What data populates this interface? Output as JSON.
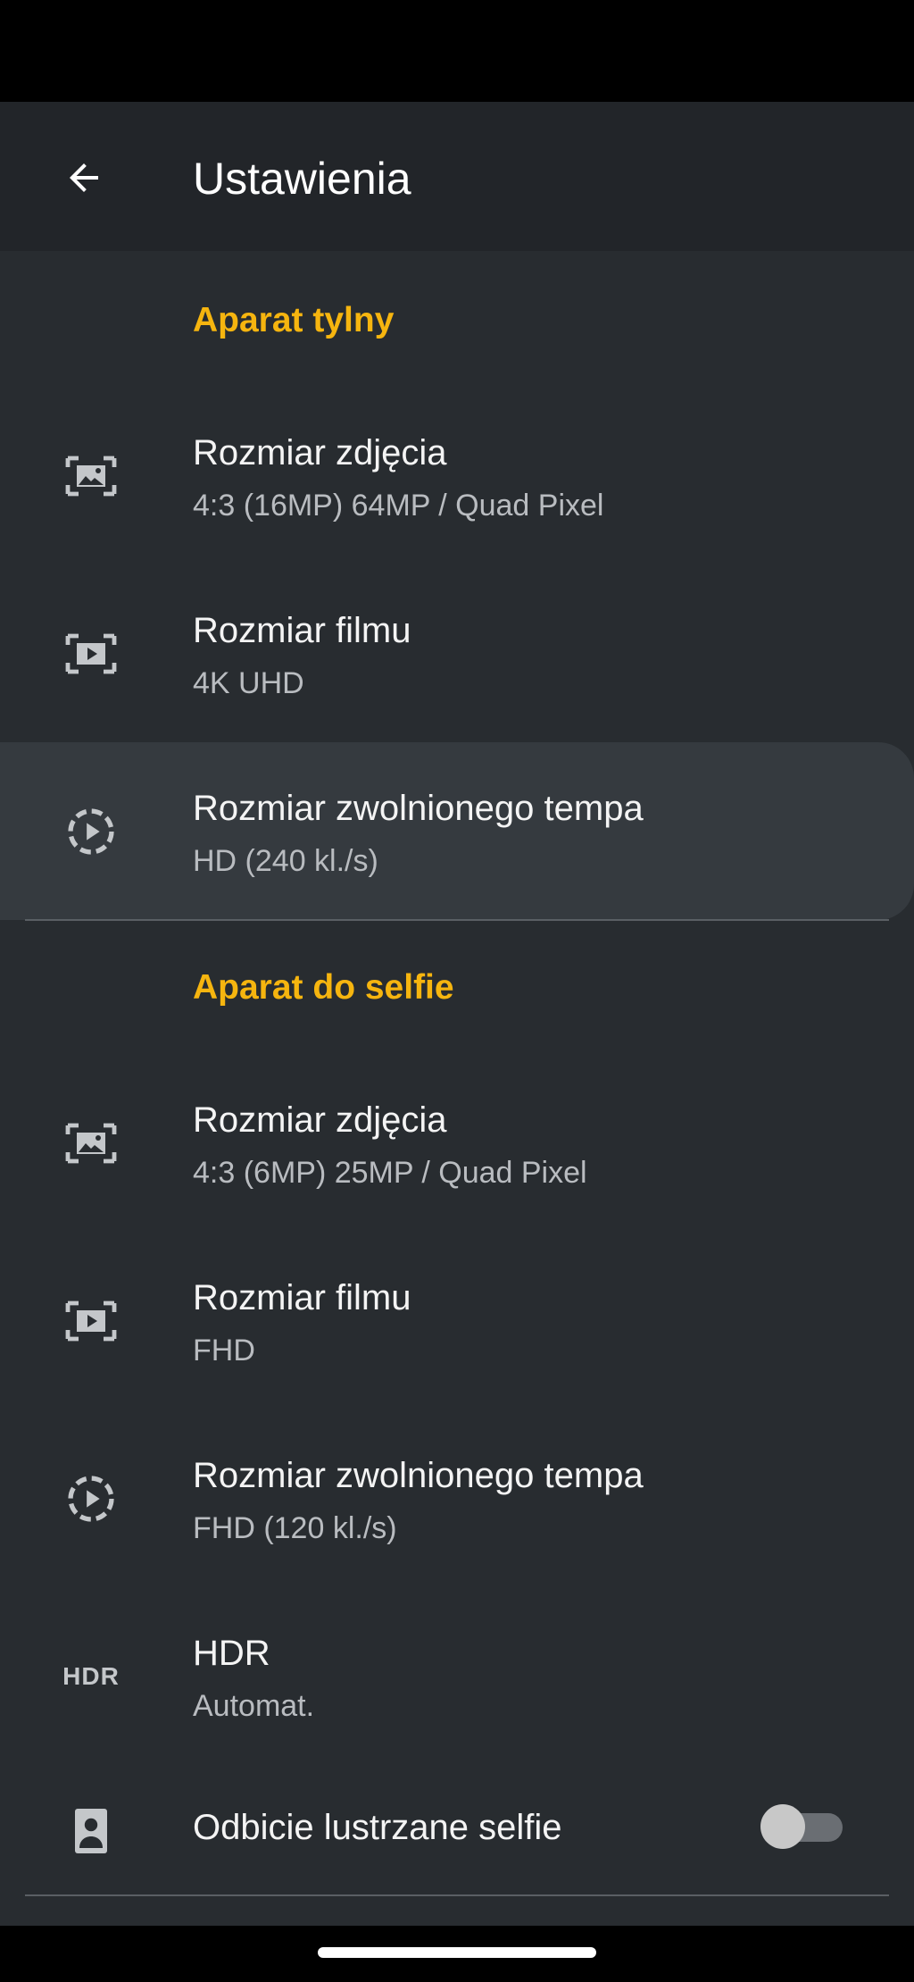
{
  "header": {
    "title": "Ustawienia"
  },
  "rear": {
    "header": "Aparat tylny",
    "items": [
      {
        "title": "Rozmiar zdjęcia",
        "value": "4:3 (16MP) 64MP / Quad Pixel",
        "icon": "photo-size-icon"
      },
      {
        "title": "Rozmiar filmu",
        "value": "4K UHD",
        "icon": "video-size-icon"
      },
      {
        "title": "Rozmiar zwolnionego tempa",
        "value": "HD (240 kl./s)",
        "icon": "slow-motion-icon"
      }
    ]
  },
  "selfie": {
    "header": "Aparat do selfie",
    "items": [
      {
        "title": "Rozmiar zdjęcia",
        "value": "4:3 (6MP) 25MP / Quad Pixel",
        "icon": "photo-size-icon"
      },
      {
        "title": "Rozmiar filmu",
        "value": "FHD",
        "icon": "video-size-icon"
      },
      {
        "title": "Rozmiar zwolnionego tempa",
        "value": "FHD (120 kl./s)",
        "icon": "slow-motion-icon"
      },
      {
        "title": "HDR",
        "value": "Automat.",
        "icon": "hdr-icon",
        "icon_text": "HDR"
      }
    ],
    "mirror": {
      "title": "Odbicie lustrzane selfie",
      "enabled": false,
      "icon": "portrait-icon"
    }
  },
  "colors": {
    "accent": "#f6b50f",
    "background": "#282c30",
    "appbar": "#222529",
    "highlight": "#353a3f"
  }
}
